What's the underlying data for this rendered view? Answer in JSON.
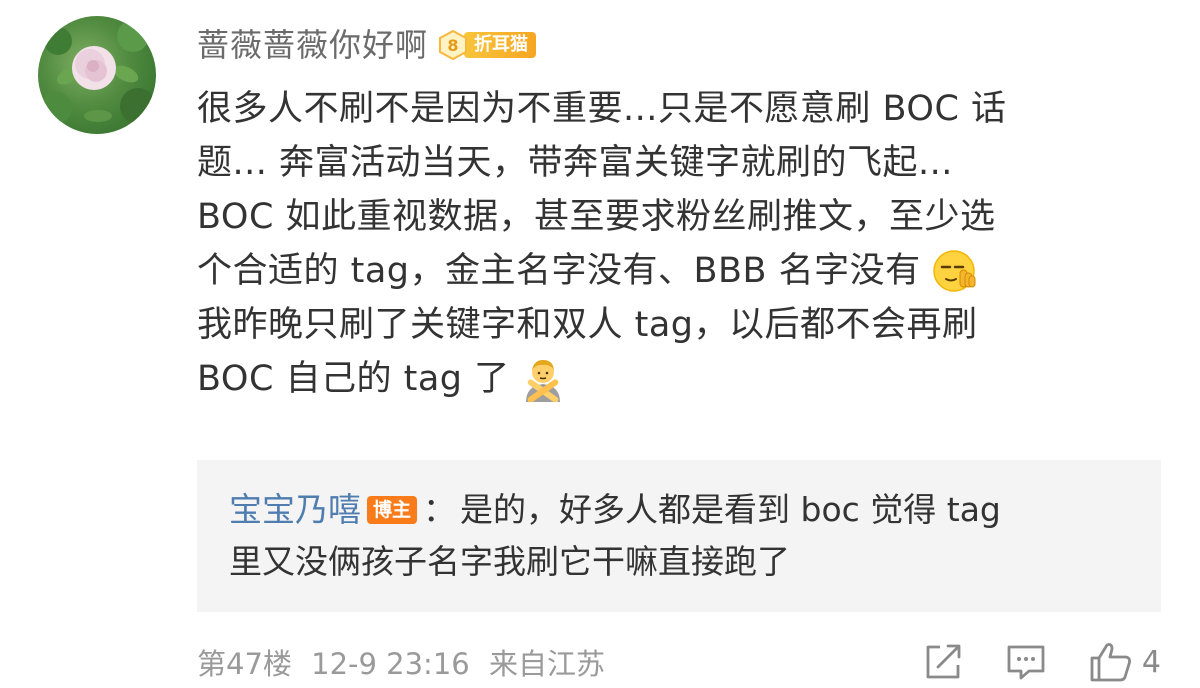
{
  "comment": {
    "username": "蔷薇蔷薇你好啊",
    "fan_badge": {
      "level": "8",
      "label": "折耳猫"
    },
    "lines": [
      "很多人不刷不是因为不重要...只是不愿意刷 BOC 话",
      "题... 奔富活动当天，带奔富关键字就刷的飞起...",
      "BOC 如此重视数据，甚至要求粉丝刷推文，至少选",
      "个合适的 tag，金主名字没有、BBB 名字没有",
      "我昨晚只刷了关键字和双人 tag，以后都不会再刷",
      "BOC 自己的 tag 了"
    ],
    "emojis": [
      "shushing-face-emoji",
      "person-gesturing-no-emoji"
    ]
  },
  "reply": {
    "author": "宝宝乃嘻",
    "author_badge": "博主",
    "colon": "：",
    "lines": [
      "是的，好多人都是看到 boc 觉得 tag",
      "里又没俩孩子名字我刷它干嘛直接跑了"
    ]
  },
  "footer": {
    "floor": "第47楼",
    "time": "12-9 23:16",
    "location": "来自江苏",
    "like_count": "4",
    "icons": [
      "share-icon",
      "comment-icon",
      "like-icon"
    ]
  },
  "colors": {
    "author_link": "#507daf",
    "meta_gray": "#9a9a9a",
    "blogger_badge": "#f97b1a",
    "fan_badge": "#f6a623",
    "reply_bg": "#f4f4f4"
  }
}
